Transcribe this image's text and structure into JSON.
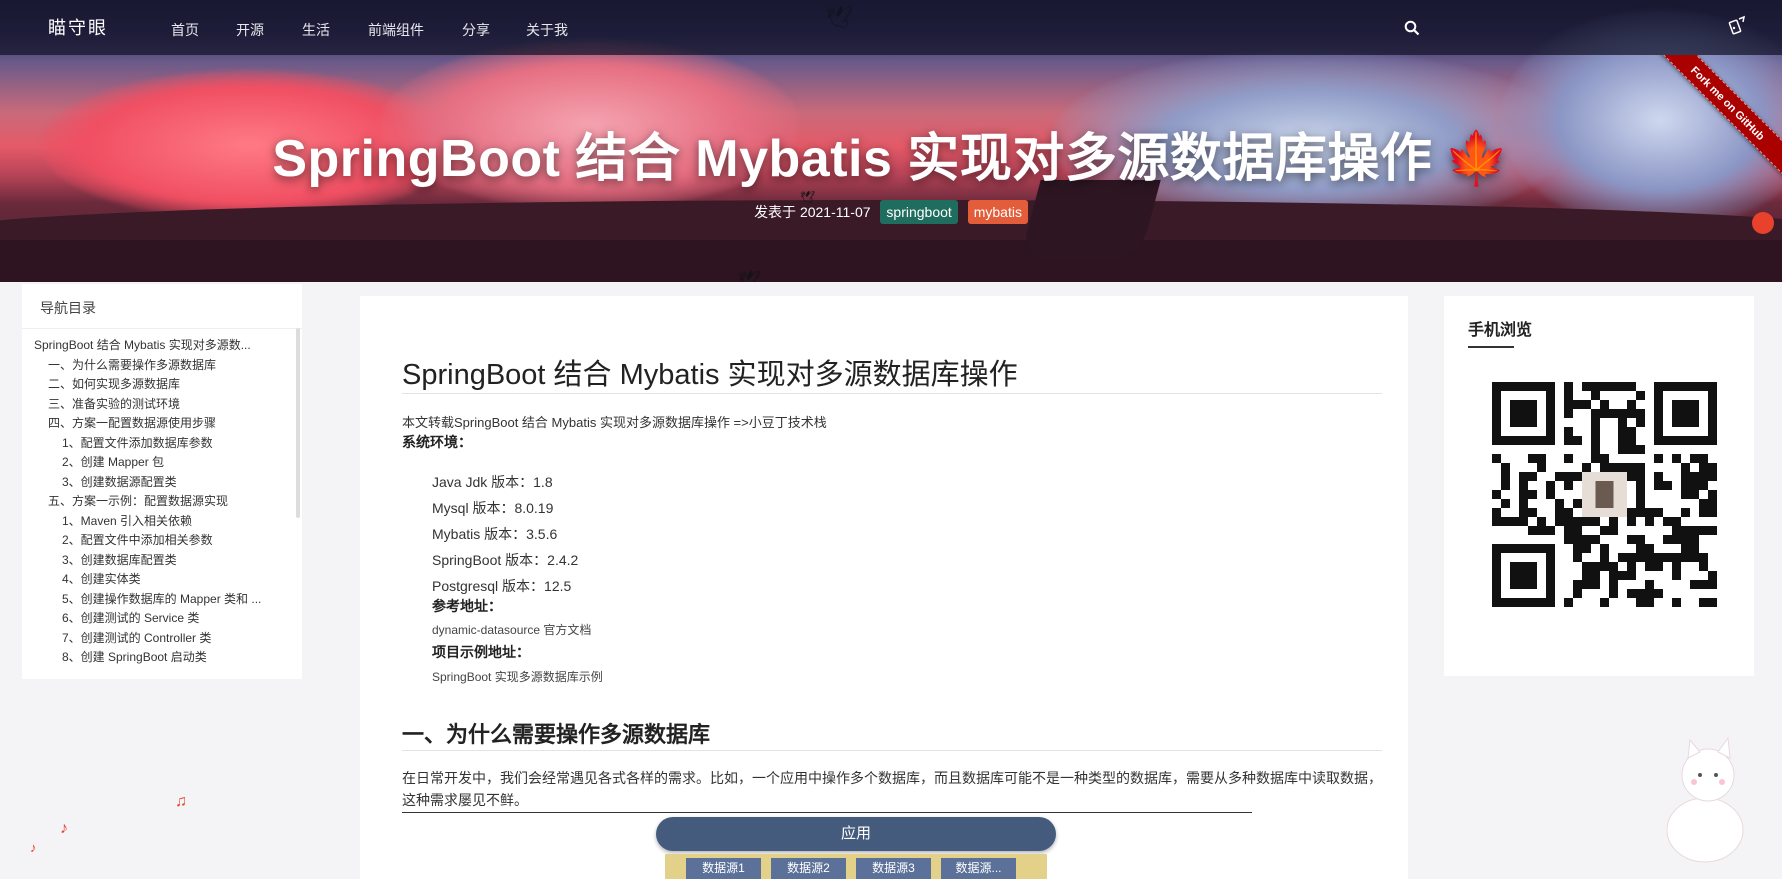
{
  "site": {
    "logo": "瞄守眼"
  },
  "nav": {
    "items": [
      "首页",
      "开源",
      "生活",
      "前端组件",
      "分享",
      "关于我"
    ]
  },
  "ribbon": {
    "label": "Fork me on GitHub"
  },
  "post": {
    "title": "SpringBoot 结合 Mybatis 实现对多源数据库操作",
    "date_label": "发表于 2021-11-07",
    "tags": [
      "springboot",
      "mybatis"
    ]
  },
  "toc": {
    "title": "导航目录",
    "items": [
      {
        "label": "SpringBoot 结合 Mybatis 实现对多源数...",
        "level": 1
      },
      {
        "label": "一、为什么需要操作多源数据库",
        "level": 2
      },
      {
        "label": "二、如何实现多源数据库",
        "level": 2
      },
      {
        "label": "三、准备实验的测试环境",
        "level": 2
      },
      {
        "label": "四、方案一配置数据源使用步骤",
        "level": 2
      },
      {
        "label": "1、配置文件添加数据库参数",
        "level": 3
      },
      {
        "label": "2、创建 Mapper 包",
        "level": 3
      },
      {
        "label": "3、创建数据源配置类",
        "level": 3
      },
      {
        "label": "五、方案一示例：配置数据源实现",
        "level": 2
      },
      {
        "label": "1、Maven 引入相关依赖",
        "level": 3
      },
      {
        "label": "2、配置文件中添加相关参数",
        "level": 3
      },
      {
        "label": "3、创建数据库配置类",
        "level": 3
      },
      {
        "label": "4、创建实体类",
        "level": 3
      },
      {
        "label": "5、创建操作数据库的 Mapper 类和 ...",
        "level": 3
      },
      {
        "label": "6、创建测试的 Service 类",
        "level": 3
      },
      {
        "label": "7、创建测试的 Controller 类",
        "level": 3
      },
      {
        "label": "8、创建 SpringBoot 启动类",
        "level": 3
      }
    ]
  },
  "article": {
    "heading": "SpringBoot 结合 Mybatis 实现对多源数据库操作",
    "repost": "本文转载SpringBoot 结合 Mybatis 实现对多源数据库操作 =>小豆丁技术栈",
    "env_label": "系统环境：",
    "env": [
      "Java Jdk 版本：1.8",
      "Mysql 版本：8.0.19",
      "Mybatis 版本：3.5.6",
      "SpringBoot 版本：2.4.2",
      "Postgresql 版本：12.5"
    ],
    "ref_label": "参考地址：",
    "ref_link": "dynamic-datasource 官方文档",
    "example_label": "项目示例地址：",
    "example_link": "SpringBoot 实现多源数据库示例",
    "section1": "一、为什么需要操作多源数据库",
    "paragraph": "在日常开发中，我们会经常遇见各式各样的需求。比如，一个应用中操作多个数据库，而且数据库可能不是一种类型的数据库，需要从多种数据库中读取数据，这种需求屡见不鲜。",
    "diagram": {
      "app": "应用",
      "sources": [
        "数据源1",
        "数据源2",
        "数据源3",
        "数据源..."
      ]
    }
  },
  "mobile": {
    "title": "手机浏览"
  }
}
